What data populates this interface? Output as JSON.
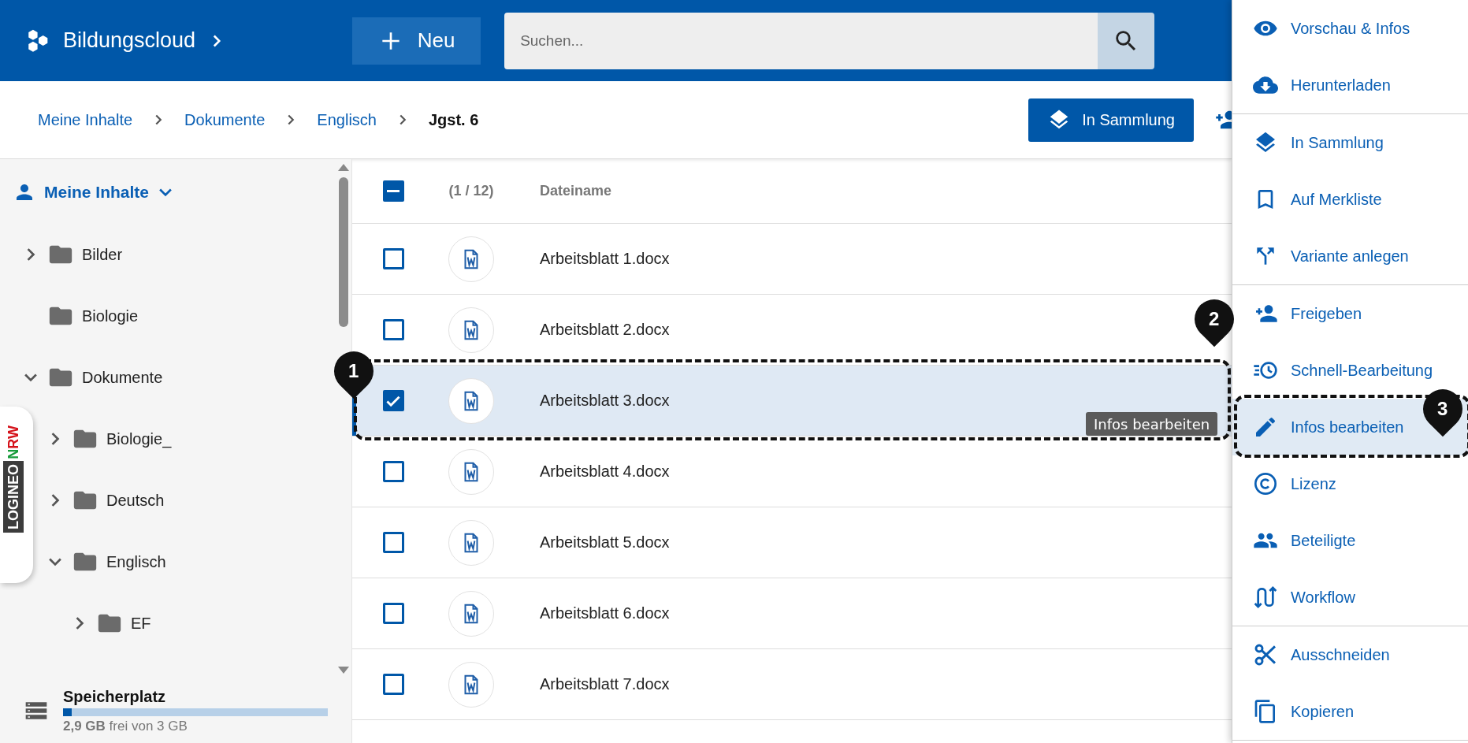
{
  "header": {
    "brand": "Bildungscloud",
    "new_button": "Neu",
    "search": {
      "placeholder": "Suchen..."
    }
  },
  "breadcrumbs": [
    {
      "label": "Meine Inhalte",
      "current": false
    },
    {
      "label": "Dokumente",
      "current": false
    },
    {
      "label": "Englisch",
      "current": false
    },
    {
      "label": "Jgst. 6",
      "current": true
    }
  ],
  "collection_button": "In Sammlung",
  "sidebar": {
    "tree": {
      "label": "Meine Inhalte",
      "expanded": true,
      "children": [
        {
          "label": "Bilder",
          "expanded": false
        },
        {
          "label": "Biologie"
        },
        {
          "label": "Dokumente",
          "expanded": true,
          "children": [
            {
              "label": "Biologie_",
              "expanded": false
            },
            {
              "label": "Deutsch",
              "expanded": false
            },
            {
              "label": "Englisch",
              "expanded": true,
              "children": [
                {
                  "label": "EF",
                  "expanded": false
                }
              ]
            }
          ]
        }
      ]
    },
    "side_tab": {
      "text": "LOGINEO",
      "suffix": "NRW"
    },
    "storage": {
      "title": "Speicherplatz",
      "level": 0.033,
      "text": "**2,9 GB** frei von 3 GB"
    }
  },
  "table": {
    "header": {
      "indeterminate": true,
      "count": "(1 / 12)",
      "column": "Dateiname"
    },
    "rows": [
      {
        "name": "Arbeitsblatt 1.docx",
        "selected": false
      },
      {
        "name": "Arbeitsblatt 2.docx",
        "selected": false
      },
      {
        "name": "Arbeitsblatt 3.docx",
        "selected": true
      },
      {
        "name": "Arbeitsblatt 4.docx",
        "selected": false
      },
      {
        "name": "Arbeitsblatt 5.docx",
        "selected": false
      },
      {
        "name": "Arbeitsblatt 6.docx",
        "selected": false
      },
      {
        "name": "Arbeitsblatt 7.docx",
        "selected": false
      }
    ],
    "tooltip": "Infos bearbeiten"
  },
  "context_menu": {
    "groups": [
      [
        {
          "label": "Vorschau & Infos",
          "selected": false
        },
        {
          "label": "Herunterladen",
          "selected": false
        }
      ],
      [
        {
          "label": "In Sammlung",
          "selected": false
        },
        {
          "label": "Auf Merkliste",
          "selected": false
        },
        {
          "label": "Variante anlegen",
          "selected": false
        }
      ],
      [
        {
          "label": "Freigeben",
          "selected": false
        },
        {
          "label": "Schnell-Bearbeitung",
          "selected": false
        },
        {
          "label": "Infos bearbeiten",
          "selected": true
        },
        {
          "label": "Lizenz",
          "selected": false
        },
        {
          "label": "Beteiligte",
          "selected": false
        },
        {
          "label": "Workflow",
          "selected": false
        }
      ],
      [
        {
          "label": "Ausschneiden",
          "selected": false
        },
        {
          "label": "Kopieren",
          "selected": false
        }
      ]
    ]
  },
  "callouts": [
    {
      "number": "1"
    },
    {
      "number": "2"
    },
    {
      "number": "3"
    }
  ]
}
